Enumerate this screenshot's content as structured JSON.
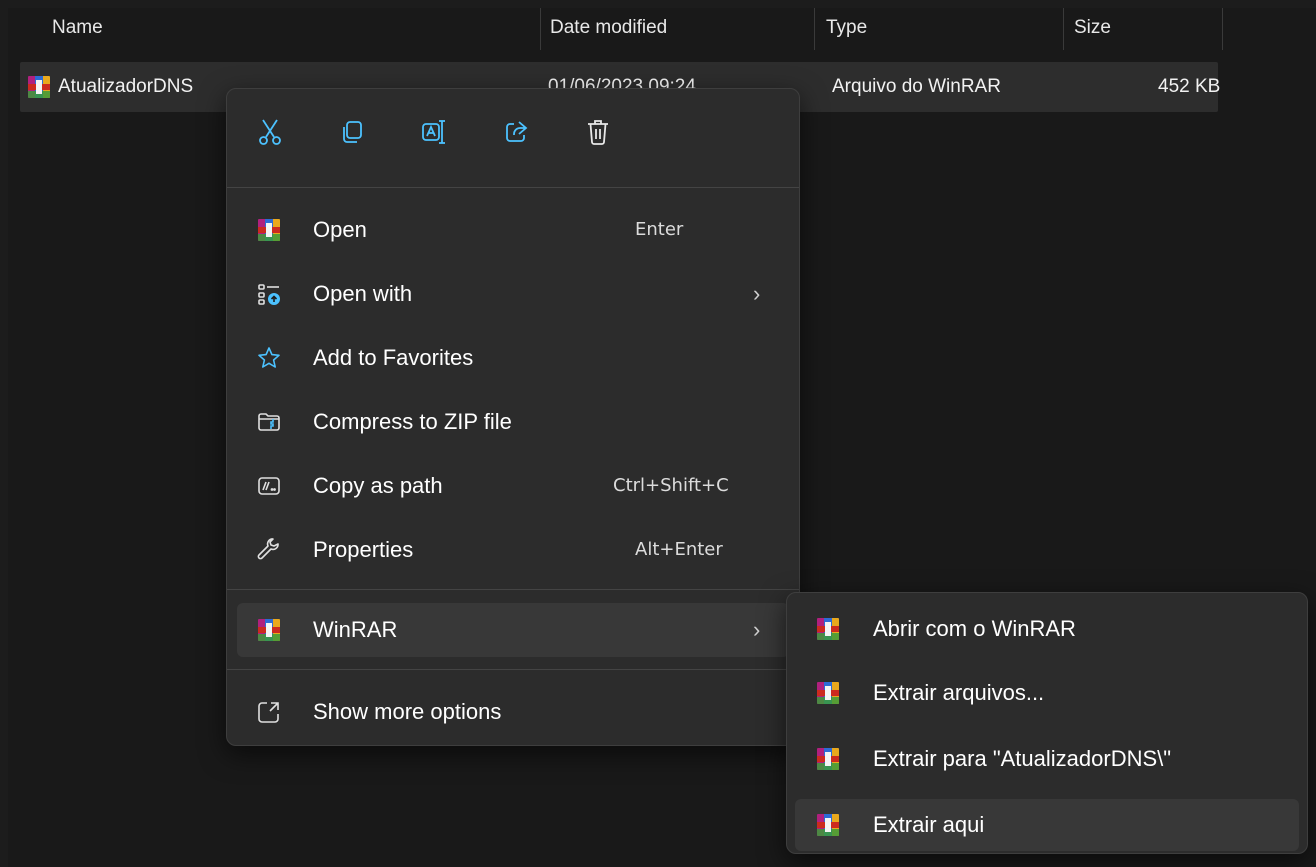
{
  "columns": {
    "name": "Name",
    "date_modified": "Date modified",
    "type": "Type",
    "size": "Size"
  },
  "file": {
    "name": "AtualizadorDNS",
    "date": "01/06/2023 09:24",
    "type": "Arquivo do WinRAR",
    "size": "452 KB",
    "icon": "winrar-icon"
  },
  "quick_actions": [
    "cut-icon",
    "copy-icon",
    "rename-icon",
    "share-icon",
    "delete-icon"
  ],
  "menu": {
    "open": {
      "label": "Open",
      "shortcut": "Enter"
    },
    "open_with": {
      "label": "Open with"
    },
    "favorites": {
      "label": "Add to Favorites"
    },
    "compress": {
      "label": "Compress to ZIP file"
    },
    "copy_path": {
      "label": "Copy as path",
      "shortcut": "Ctrl+Shift+C"
    },
    "properties": {
      "label": "Properties",
      "shortcut": "Alt+Enter"
    },
    "winrar": {
      "label": "WinRAR"
    },
    "more_options": {
      "label": "Show more options"
    }
  },
  "submenu": {
    "items": [
      {
        "label": "Abrir com o WinRAR"
      },
      {
        "label": "Extrair arquivos..."
      },
      {
        "label": "Extrair para \"AtualizadorDNS\\\""
      },
      {
        "label": "Extrair aqui"
      }
    ]
  },
  "colors": {
    "accent": "#4cc2ff",
    "menu_bg": "#2c2c2c",
    "selection": "#2d2d2d"
  }
}
